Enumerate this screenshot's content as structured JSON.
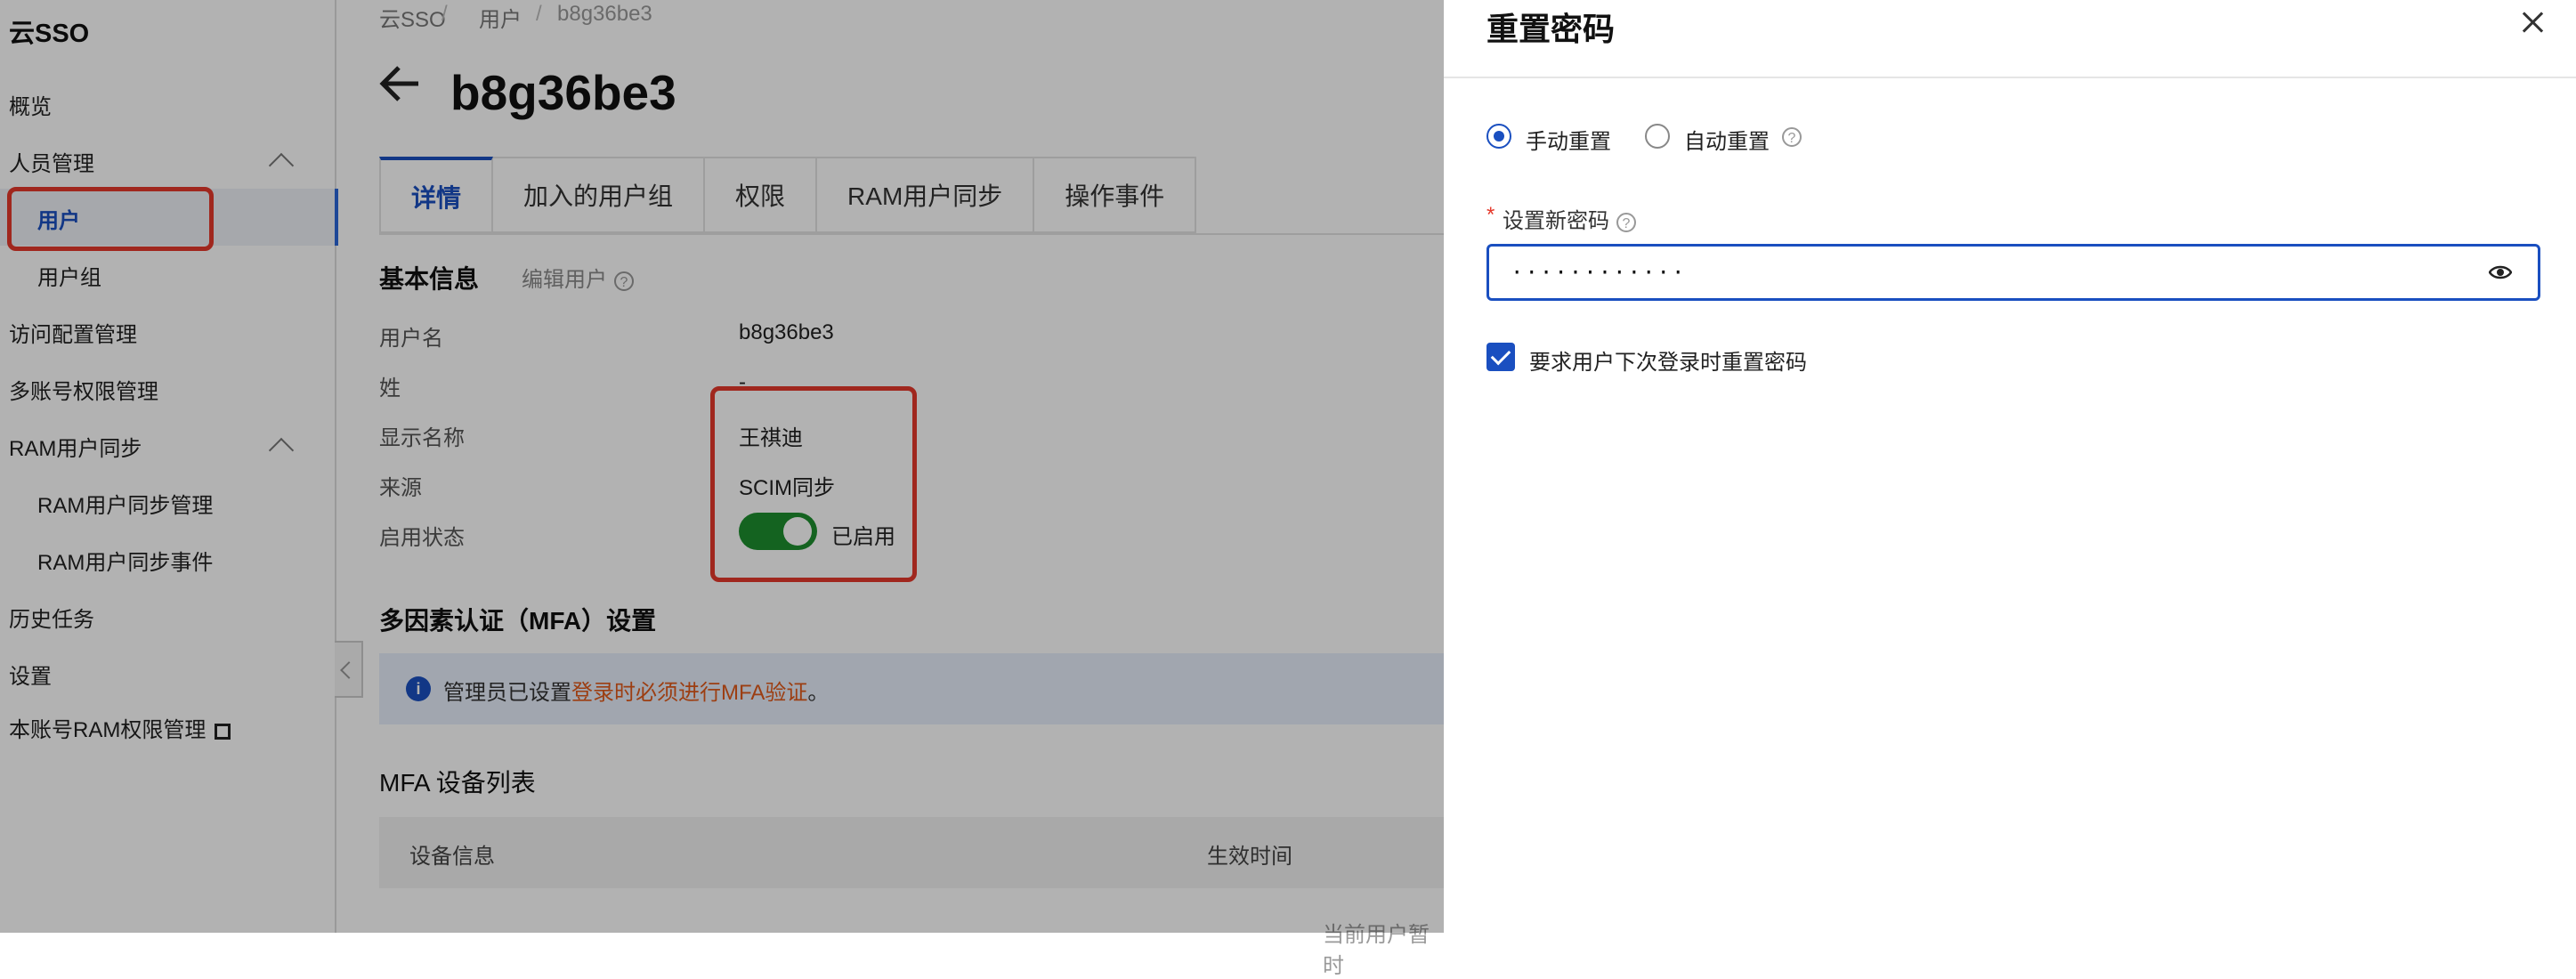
{
  "sidebar": {
    "brand": "云SSO",
    "items": [
      {
        "label": "概览"
      },
      {
        "label": "人员管理"
      },
      {
        "label": "用户"
      },
      {
        "label": "用户组"
      },
      {
        "label": "访问配置管理"
      },
      {
        "label": "多账号权限管理"
      },
      {
        "label": "RAM用户同步"
      },
      {
        "label": "RAM用户同步管理"
      },
      {
        "label": "RAM用户同步事件"
      },
      {
        "label": "历史任务"
      },
      {
        "label": "设置"
      },
      {
        "label": "本账号RAM权限管理"
      }
    ]
  },
  "breadcrumb": {
    "items": [
      "云SSO",
      "用户",
      "b8g36be3"
    ],
    "separator": "/"
  },
  "page": {
    "title": "b8g36be3"
  },
  "tabs": [
    {
      "label": "详情",
      "active": true
    },
    {
      "label": "加入的用户组"
    },
    {
      "label": "权限"
    },
    {
      "label": "RAM用户同步"
    },
    {
      "label": "操作事件"
    }
  ],
  "basic_info": {
    "title": "基本信息",
    "edit_label": "编辑用户",
    "help_glyph": "?",
    "fields": [
      {
        "label": "用户名",
        "value": "b8g36be3"
      },
      {
        "label": "姓",
        "value": "-"
      },
      {
        "label": "显示名称",
        "value": "王祺迪"
      },
      {
        "label": "来源",
        "value": "SCIM同步"
      },
      {
        "label": "启用状态",
        "value": "已启用"
      }
    ],
    "enabled": true
  },
  "mfa": {
    "title": "多因素认证（MFA）设置",
    "info_icon_glyph": "i",
    "info_prefix": "管理员已设置",
    "info_highlight": "登录时必须进行MFA验证",
    "info_suffix": "。",
    "device_list_title": "MFA 设备列表",
    "columns": [
      "设备信息",
      "生效时间"
    ],
    "footer_note": "当前用户暂时"
  },
  "drawer": {
    "title": "重置密码",
    "radio_options": [
      {
        "label": "手动重置",
        "checked": true
      },
      {
        "label": "自动重置",
        "checked": false
      }
    ],
    "required_mark": "*",
    "password_label": "设置新密码",
    "password_value": "············",
    "require_reset_label": "要求用户下次登录时重置密码",
    "require_reset_checked": true
  },
  "colors": {
    "accent": "#1a4fc0",
    "highlight_box": "#e5392b",
    "toggle_on": "#1e8e2e",
    "info_highlight": "#e05a1a"
  }
}
